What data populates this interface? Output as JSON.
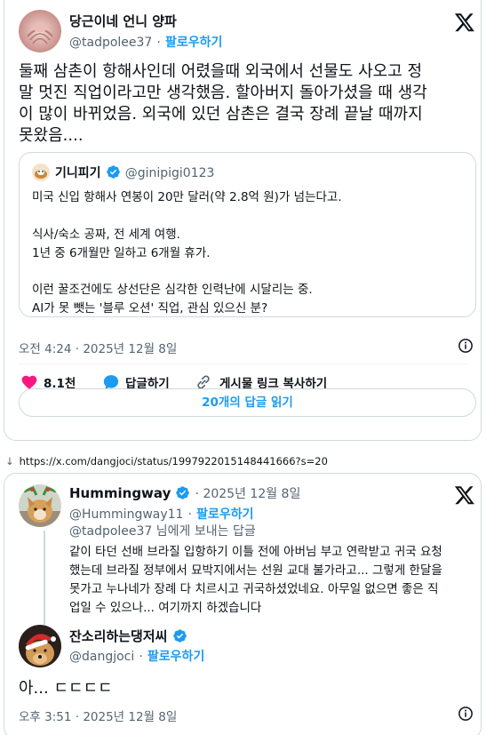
{
  "tweet1": {
    "author_name": "당근이네 언니 양파",
    "handle": "@tadpolee37",
    "separator": "·",
    "follow_label": "팔로우하기",
    "text_lines": [
      "둘째 삼촌이 항해사인데 어렸을때 외국에서 선물도 사오고 정",
      "말 멋진 직업이라고만 생각했음. 할아버지 돌아가셨을 때 생각",
      "이 많이 바뀌었음. 외국에 있던 삼촌은 결국 장례 끝날 때까지",
      "못왔음...."
    ],
    "quote": {
      "author_name": "기니피기",
      "handle": "@ginipigi0123",
      "lines": [
        "미국 신입 항해사 연봉이 20만 달러(약 2.8억 원)가 넘는다고.",
        "식사/숙소 공짜, 전 세계 여행.",
        "1년 중 6개월만 일하고 6개월 휴가.",
        "이런 꿀조건에도 상선단은 심각한 인력난에 시달리는 중.",
        "AI가 못 뺏는 '블루 오션' 직업, 관심 있으신 분?"
      ]
    },
    "timestamp": "오전 4:24 · 2025년 12월 8일",
    "likes": "8.1천",
    "reply_label": "답글하기",
    "copy_link_label": "게시물 링크 복사하기",
    "read_replies_label": "20개의 답글 읽기"
  },
  "url_bar": {
    "arrow": "↓",
    "url": "https://x.com/dangjoci/status/1997922015148441666?s=20"
  },
  "tweet2": {
    "author_name": "Hummingway",
    "date": "· 2025년 12월 8일",
    "handle": "@Hummingway11",
    "separator": "·",
    "follow_label": "팔로우하기",
    "reply_to": "@tadpolee37 님에게 보내는 답글",
    "text_lines": [
      "같이 타던 선배 브라질 입항하기 이틀 전에 아버님 부고 연락받고 귀국 요청",
      "했는데 브라질 정부에서 묘박지에서는 선원 교대 불가라고... 그렇게 한달을",
      "못가고 누나네가 장례 다 치르시고 귀국하셨었네요. 아무일 없으면 좋은 직",
      "업일 수 있으나... 여기까지 하겠습니다"
    ]
  },
  "tweet3": {
    "author_name": "잔소리하는댕저씨",
    "handle": "@dangjoci",
    "separator": "·",
    "follow_label": "팔로우하기",
    "text": "아... ㄷㄷㄷㄷ",
    "timestamp": "오후 3:51 · 2025년 12월 8일"
  },
  "colors": {
    "accent": "#1d9bf0",
    "like": "#f91880",
    "border": "#cfd9de",
    "muted": "#536471",
    "text": "#0f1419"
  },
  "icons": [
    "x-logo-icon",
    "verified-badge-icon",
    "heart-icon",
    "reply-bubble-icon",
    "link-icon",
    "info-icon",
    "down-arrow-icon"
  ]
}
